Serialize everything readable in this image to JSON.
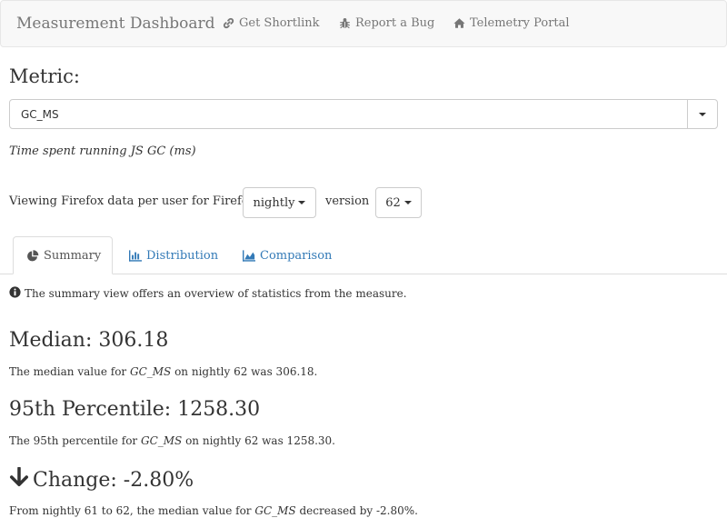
{
  "navbar": {
    "brand": "Measurement Dashboard",
    "links": [
      {
        "label": "Get Shortlink",
        "icon": "link-icon"
      },
      {
        "label": "Report a Bug",
        "icon": "bug-icon"
      },
      {
        "label": "Telemetry Portal",
        "icon": "home-icon"
      }
    ]
  },
  "metric": {
    "label": "Metric:",
    "selected": "GC_MS",
    "description": "Time spent running JS GC (ms)"
  },
  "viewing": {
    "prefix": "Viewing Firefox data per user for Firefox",
    "channel": "nightly",
    "version_label": "version",
    "version": "62"
  },
  "tabs": [
    {
      "label": "Summary",
      "icon": "pie-chart-icon",
      "active": true
    },
    {
      "label": "Distribution",
      "icon": "bar-chart-icon",
      "active": false
    },
    {
      "label": "Comparison",
      "icon": "area-chart-icon",
      "active": false
    }
  ],
  "summary": {
    "info": "The summary view offers an overview of statistics from the measure.",
    "median": {
      "heading": "Median: 306.18",
      "text_pre": "The median value for ",
      "metric": "GC_MS",
      "text_post": " on nightly 62 was 306.18."
    },
    "p95": {
      "heading": "95th Percentile: 1258.30",
      "text_pre": "The 95th percentile for ",
      "metric": "GC_MS",
      "text_post": " on nightly 62 was 1258.30."
    },
    "change": {
      "heading": "Change: -2.80%",
      "icon": "arrow-down-icon",
      "text_pre": "From nightly 61 to 62, the median value for ",
      "metric": "GC_MS",
      "text_post": " decreased by -2.80%."
    }
  },
  "colors": {
    "link": "#337ab7",
    "text": "#333333",
    "nav_bg": "#f8f8f8",
    "nav_text": "#777777"
  }
}
